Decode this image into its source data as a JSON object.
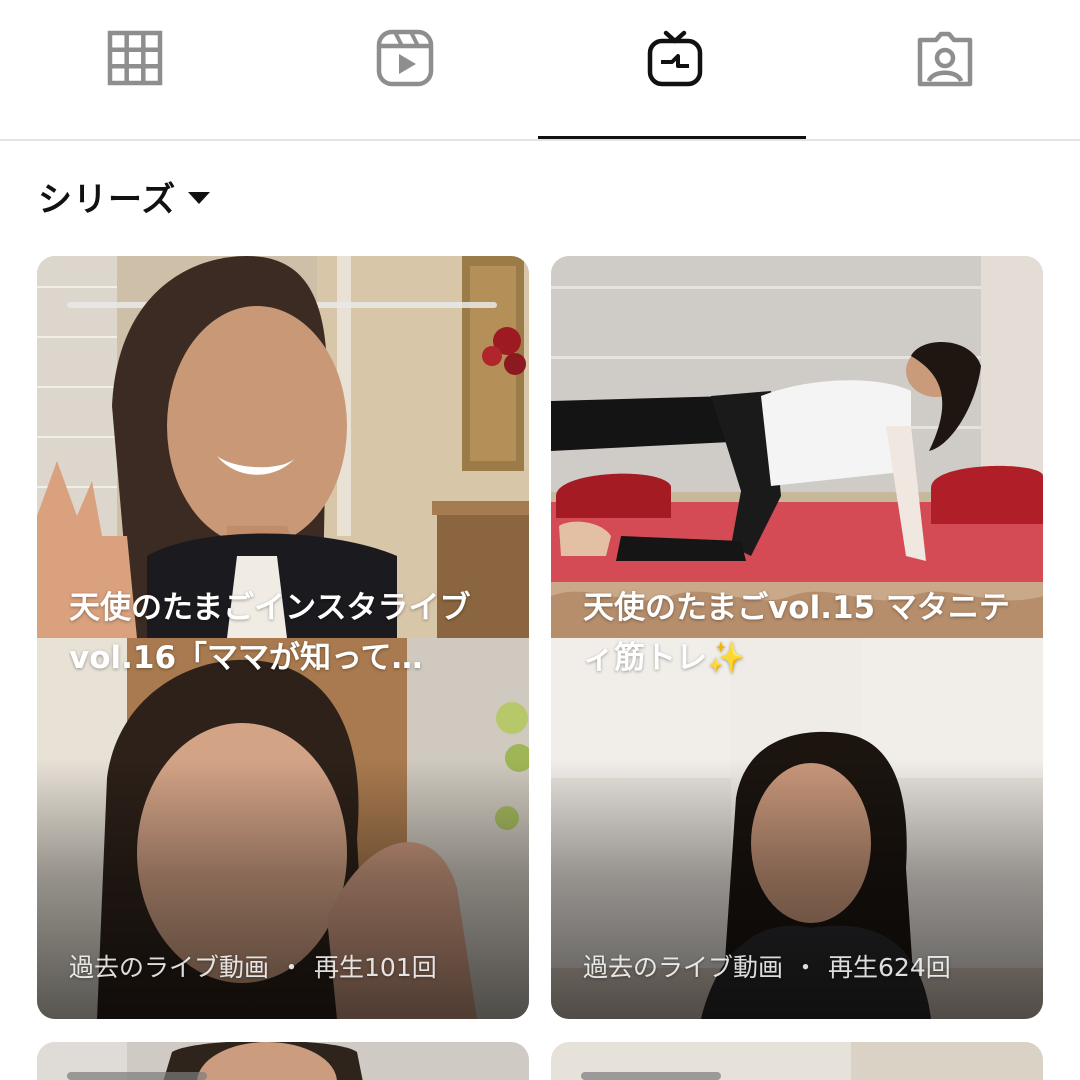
{
  "tabs": [
    {
      "name": "grid",
      "icon": "grid-icon",
      "active": false
    },
    {
      "name": "reels",
      "icon": "reels-icon",
      "active": false
    },
    {
      "name": "igtv",
      "icon": "igtv-icon",
      "active": true
    },
    {
      "name": "tagged",
      "icon": "tagged-person-icon",
      "active": false
    }
  ],
  "series": {
    "label": "シリーズ",
    "icon": "caret-down-icon"
  },
  "cards": [
    {
      "title": "天使のたまごインスタライブvol.16「ママが知って…",
      "meta_type": "過去のライブ動画",
      "meta_separator": "・",
      "meta_views": "再生101回"
    },
    {
      "title": "天使のたまごvol.15 マタニティ筋トレ✨",
      "meta_type": "過去のライブ動画",
      "meta_separator": "・",
      "meta_views": "再生624回"
    }
  ],
  "colors": {
    "active_icon": "#111111",
    "inactive_icon": "#8e8e8e",
    "divider": "#e4e4e4",
    "yoga_mat": "#e0424f"
  }
}
